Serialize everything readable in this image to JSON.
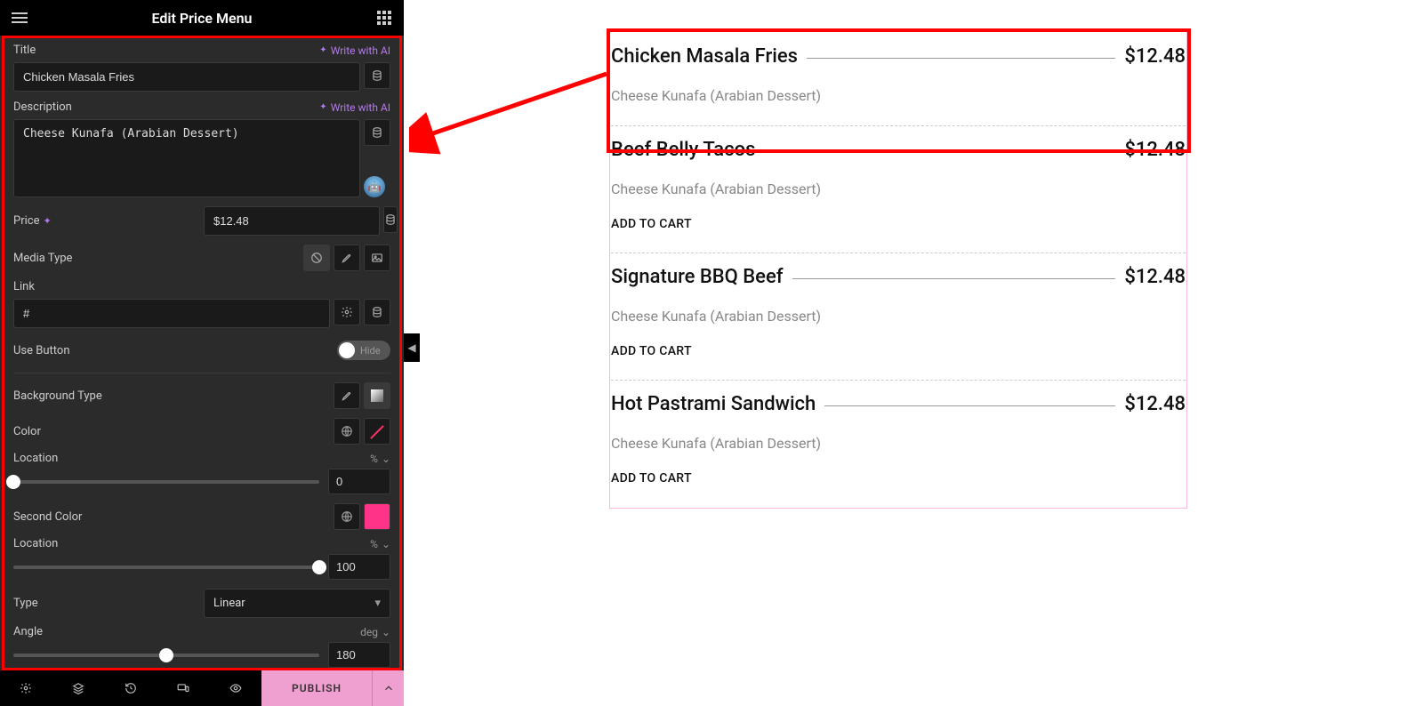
{
  "sidebar": {
    "title": "Edit Price Menu",
    "titleLabel": "Title",
    "writeAI": "Write with AI",
    "titleValue": "Chicken Masala Fries",
    "descLabel": "Description",
    "descValue": "Cheese Kunafa (Arabian Dessert)",
    "priceLabel": "Price",
    "priceValue": "$12.48",
    "mediaLabel": "Media Type",
    "linkLabel": "Link",
    "linkValue": "#",
    "useButtonLabel": "Use Button",
    "useButtonState": "Hide",
    "bgTypeLabel": "Background Type",
    "colorLabel": "Color",
    "locationLabel": "Location",
    "locationUnit": "%",
    "locationValue": "0",
    "secondColorLabel": "Second Color",
    "location2Value": "100",
    "typeLabel": "Type",
    "typeValue": "Linear",
    "angleLabel": "Angle",
    "angleUnit": "deg",
    "angleValue": "180"
  },
  "bottom": {
    "publish": "PUBLISH"
  },
  "menu": {
    "items": [
      {
        "title": "Chicken Masala Fries",
        "price": "$12.48",
        "desc": "Cheese Kunafa (Arabian Dessert)",
        "addToCart": "",
        "highlighted": true
      },
      {
        "title": "Beef Belly Tacos",
        "price": "$12.48",
        "desc": "Cheese Kunafa (Arabian Dessert)",
        "addToCart": "ADD TO CART"
      },
      {
        "title": "Signature BBQ Beef",
        "price": "$12.48",
        "desc": "Cheese Kunafa (Arabian Dessert)",
        "addToCart": "ADD TO CART"
      },
      {
        "title": "Hot Pastrami Sandwich",
        "price": "$12.48",
        "desc": "Cheese Kunafa (Arabian Dessert)",
        "addToCart": "ADD TO CART"
      }
    ]
  }
}
